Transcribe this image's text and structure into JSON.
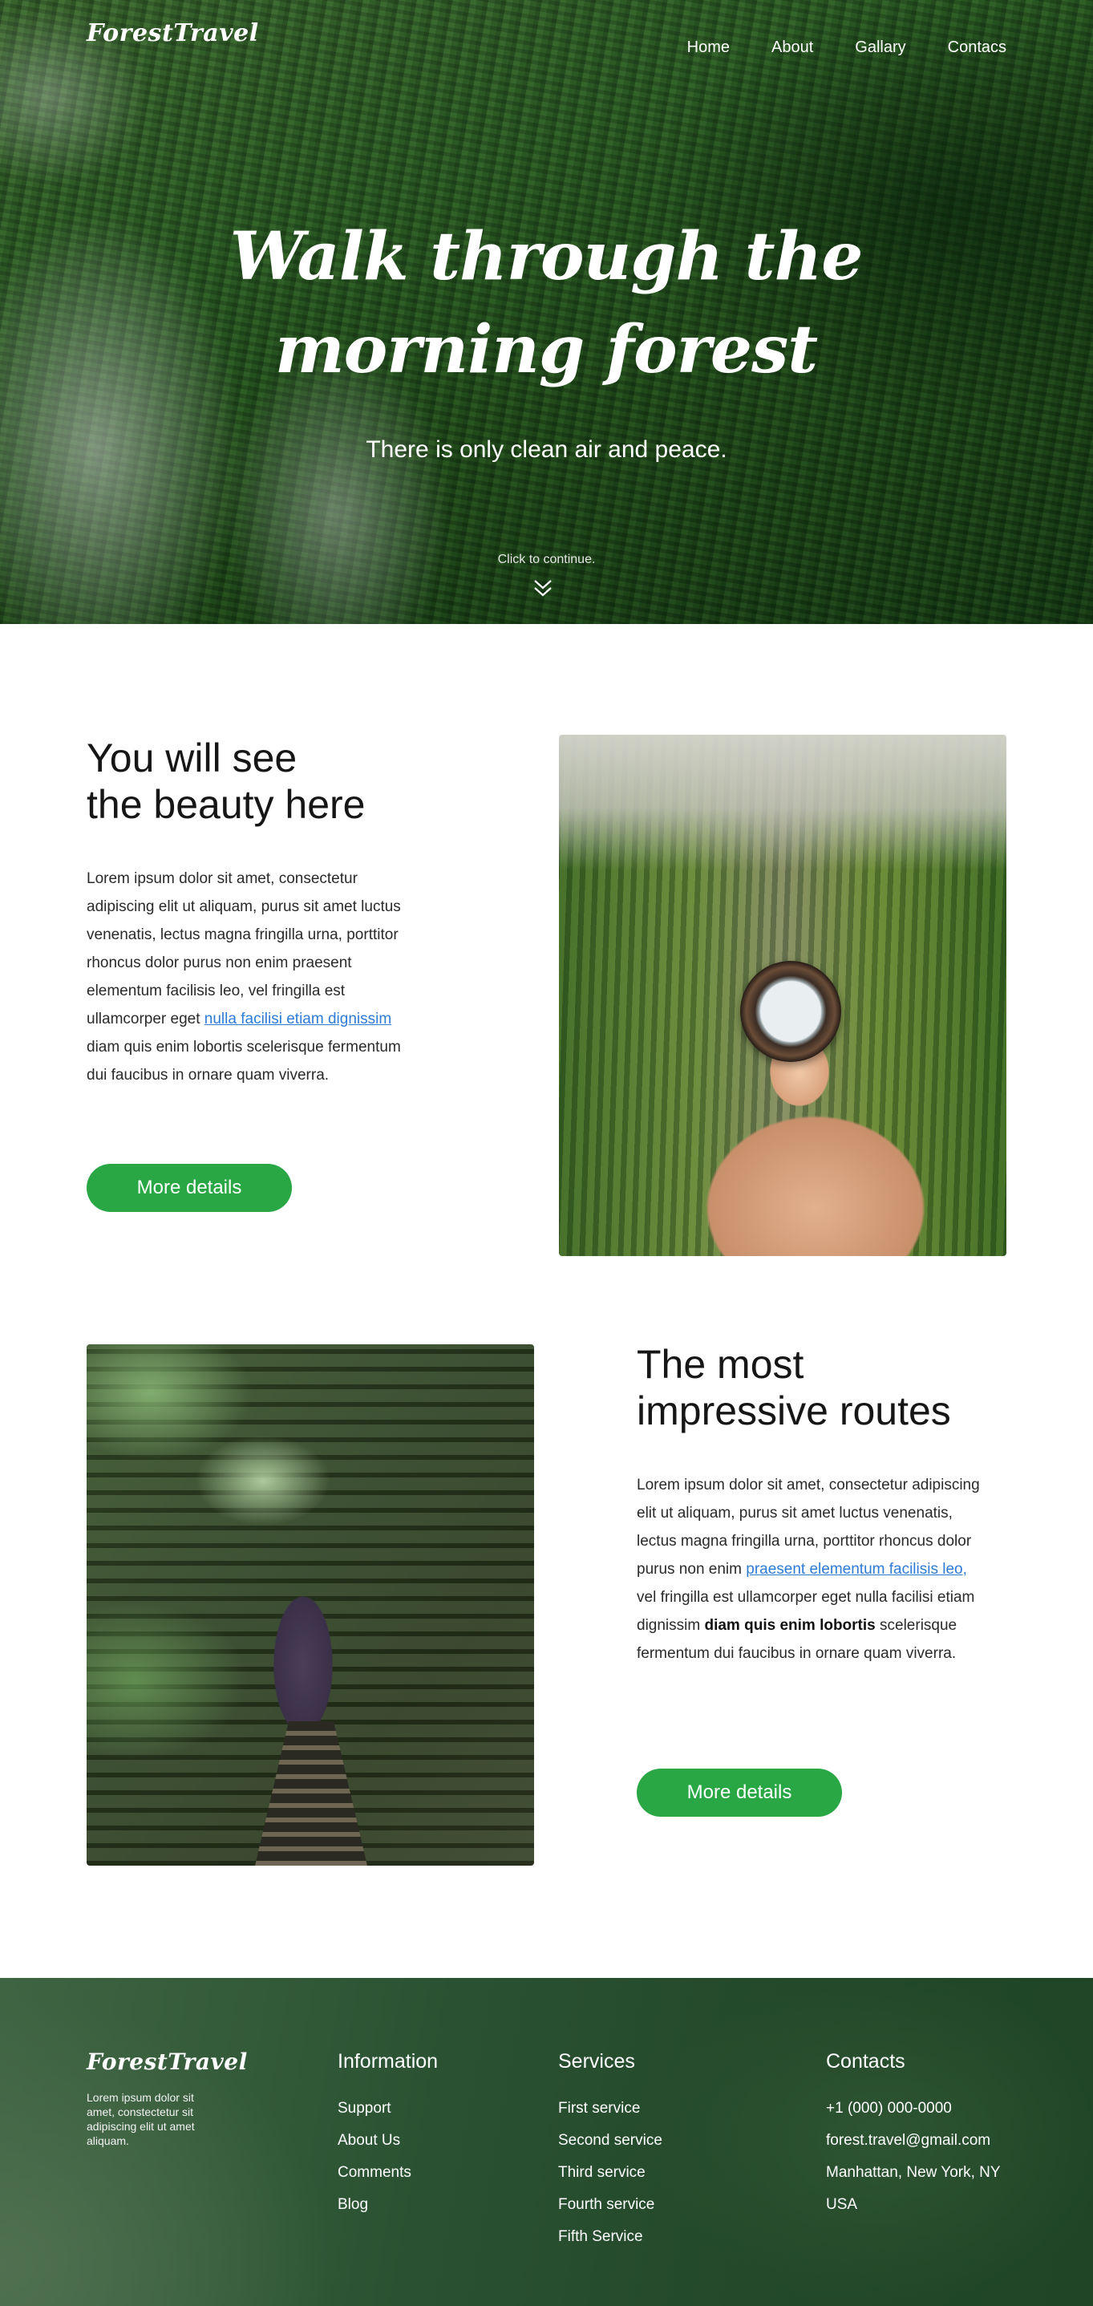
{
  "header": {
    "logo": "ForestTravel",
    "nav": [
      "Home",
      "About",
      "Gallary",
      "Contacs"
    ]
  },
  "hero": {
    "title": "Walk through the morning forest",
    "subtitle": "There is only clean air and peace.",
    "cta_hint": "Click to continue."
  },
  "feature1": {
    "title_line1": "You will see",
    "title_line2": "the beauty here",
    "text_before_link": "Lorem ipsum dolor sit amet, consectetur adipiscing elit ut aliquam, purus sit amet luctus venenatis, lectus magna fringilla urna, porttitor rhoncus dolor purus non enim praesent elementum facilisis leo, vel fringilla est ullamcorper eget ",
    "link_text": "nulla facilisi etiam dignissim ",
    "text_after_link": "diam quis enim lobortis scelerisque fermentum dui faucibus in ornare quam viverra.",
    "button": "More details"
  },
  "feature2": {
    "title_line1": "The most",
    "title_line2": "impressive routes",
    "text_before_link": "Lorem ipsum dolor sit amet, consectetur adipiscing elit ut aliquam, purus sit amet luctus venenatis, lectus magna fringilla urna, porttitor rhoncus dolor purus non enim ",
    "link_text": "praesent elementum facilisis leo,",
    "text_middle": " vel fringilla est ullamcorper eget nulla facilisi etiam dignissim ",
    "bold_text": "diam quis enim lobortis",
    "text_after_bold": " scelerisque fermentum dui faucibus in ornare quam viverra.",
    "button": "More details"
  },
  "footer": {
    "logo": "ForestTravel",
    "description": "Lorem ipsum dolor sit amet, constectetur sit adipiscing elit ut amet aliquam.",
    "information": {
      "heading": "Information",
      "items": [
        "Support",
        "About Us",
        "Comments",
        "Blog"
      ]
    },
    "services": {
      "heading": "Services",
      "items": [
        "First service",
        "Second service",
        "Third service",
        "Fourth service",
        "Fifth Service"
      ]
    },
    "contacts": {
      "heading": "Contacts",
      "phone": "+1 (000) 000-0000",
      "email": "forest.travel@gmail.com",
      "address": "Manhattan, New York, NY",
      "country": "USA"
    }
  },
  "colors": {
    "accent_green": "#2aa745",
    "link_blue": "#2e7bd6",
    "footer_green": "#23482a"
  }
}
